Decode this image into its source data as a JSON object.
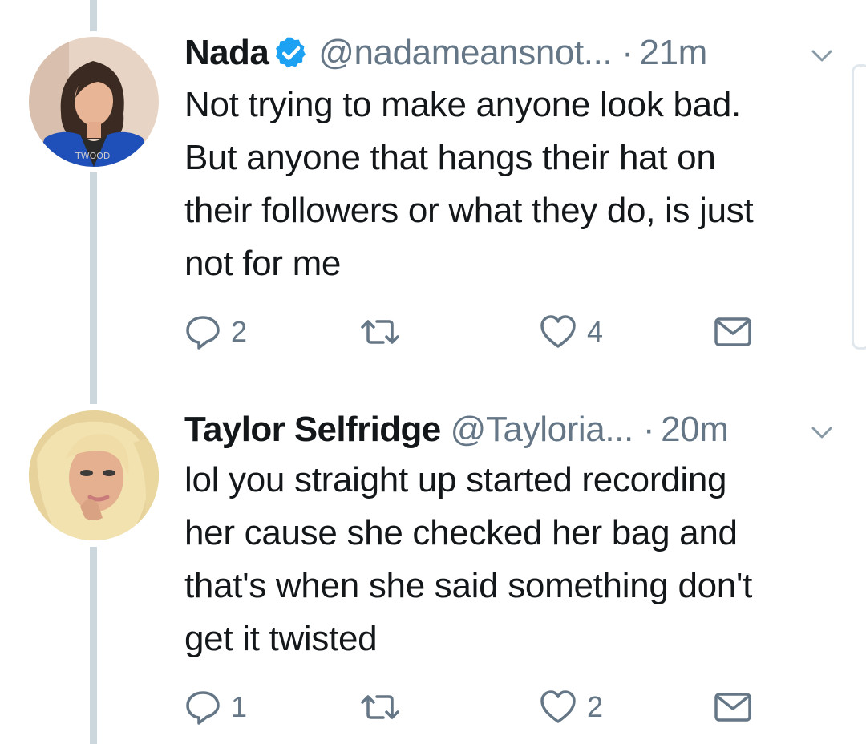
{
  "tweets": [
    {
      "display_name": "Nada",
      "verified": true,
      "handle": "@nadameansnot...",
      "separator": "·",
      "time": "21m",
      "text_lines": [
        "Not trying to make anyone look bad.",
        "But anyone that hangs their hat on",
        "their followers or what they do, is just",
        "not for me"
      ],
      "reply_count": "2",
      "retweet_count": "",
      "like_count": "4",
      "avatar_caption": "TWOOD"
    },
    {
      "display_name": "Taylor Selfridge",
      "verified": false,
      "handle": "@Tayloria...",
      "separator": "·",
      "time": "20m",
      "text_lines": [
        "lol you straight up started recording",
        "her cause she checked her bag and",
        "that's when she said something don't",
        "get it twisted"
      ],
      "reply_count": "1",
      "retweet_count": "",
      "like_count": "2"
    }
  ],
  "icons": {
    "verified": "verified-badge-icon",
    "caret": "chevron-down-icon",
    "reply": "reply-icon",
    "retweet": "retweet-icon",
    "like": "heart-icon",
    "message": "envelope-icon"
  },
  "colors": {
    "text": "#14171a",
    "secondary": "#657786",
    "verified_blue": "#1da1f2",
    "thread_line": "#ccd6dd"
  }
}
